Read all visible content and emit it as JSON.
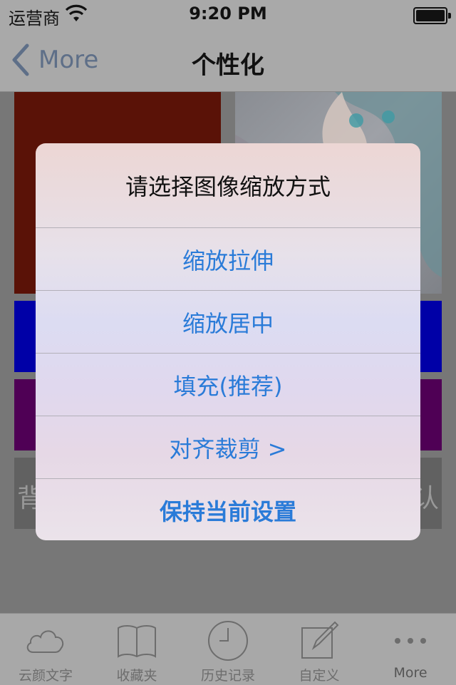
{
  "status_bar": {
    "carrier": "运营商",
    "time": "9:20 PM"
  },
  "nav": {
    "back_label": "More",
    "title": "个性化"
  },
  "background_tiles": {
    "left_text": "背",
    "right_text": "认"
  },
  "alert": {
    "title": "请选择图像缩放方式",
    "options": [
      "缩放拉伸",
      "缩放居中",
      "填充(推荐)",
      "对齐裁剪 >",
      "保持当前设置"
    ]
  },
  "tabs": [
    {
      "label": "云颜文字",
      "icon": "cloud-icon"
    },
    {
      "label": "收藏夹",
      "icon": "book-icon"
    },
    {
      "label": "历史记录",
      "icon": "clock-icon"
    },
    {
      "label": "自定义",
      "icon": "edit-icon"
    },
    {
      "label": "More",
      "icon": "more-icon"
    }
  ],
  "colors": {
    "accent": "#2a7bd8",
    "nav_back": "#5e6f88"
  }
}
